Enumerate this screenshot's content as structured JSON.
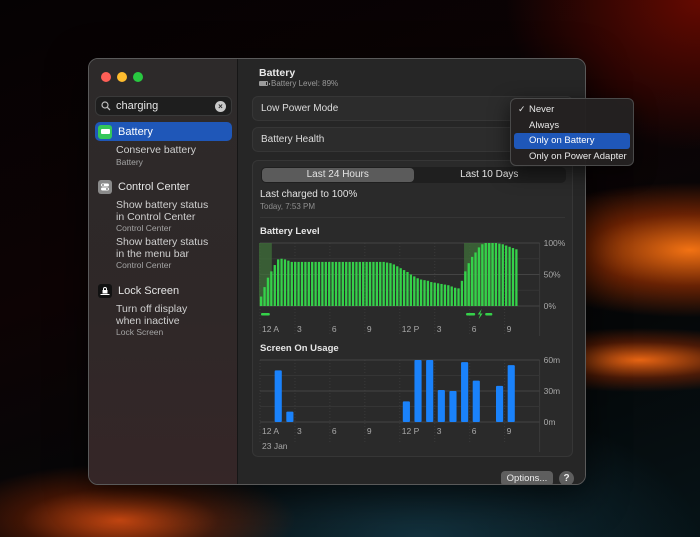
{
  "window": {
    "traffic_lights": [
      "close",
      "minimize",
      "zoom"
    ]
  },
  "sidebar": {
    "search": {
      "value": "charging",
      "placeholder": "Search"
    },
    "results": [
      {
        "label": "Battery",
        "icon": "battery-icon",
        "active": true,
        "subitems": [
          {
            "title": "Conserve battery",
            "category": "Battery"
          }
        ]
      },
      {
        "label": "Control Center",
        "icon": "control-center-icon",
        "active": false,
        "subitems": [
          {
            "title": "Show battery status in Control Center",
            "category": "Control Center"
          },
          {
            "title": "Show battery status in the menu bar",
            "category": "Control Center"
          }
        ]
      },
      {
        "label": "Lock Screen",
        "icon": "lock-screen-icon",
        "active": false,
        "subitems": [
          {
            "title": "Turn off display when inactive",
            "category": "Lock Screen"
          }
        ]
      }
    ]
  },
  "main": {
    "header": {
      "title": "Battery",
      "subtitle": "Battery Level: 89%"
    },
    "rows": [
      {
        "label": "Low Power Mode"
      },
      {
        "label": "Battery Health"
      }
    ],
    "tabs": [
      {
        "label": "Last 24 Hours",
        "selected": true
      },
      {
        "label": "Last 10 Days",
        "selected": false
      }
    ],
    "last_charged": {
      "title": "Last charged to 100%",
      "time": "Today, 7:53 PM"
    },
    "options_label": "Options...",
    "help_label": "?"
  },
  "dropdown": {
    "items": [
      {
        "label": "Never",
        "checked": true,
        "highlighted": false
      },
      {
        "label": "Always",
        "checked": false,
        "highlighted": false
      },
      {
        "label": "Only on Battery",
        "checked": false,
        "highlighted": true
      },
      {
        "label": "Only on Power Adapter",
        "checked": false,
        "highlighted": false
      }
    ]
  },
  "colors": {
    "accent": "#1f57b8",
    "battery_bar": "#35d14a",
    "charging_band": "#3f6f3a",
    "usage_bar": "#1a82fb"
  },
  "chart_data": [
    {
      "type": "bar",
      "title": "Battery Level",
      "x_unit": "20-minute intervals from 12 AM",
      "x_tick_labels": [
        "12 A",
        "3",
        "6",
        "9",
        "12 P",
        "3",
        "6",
        "9"
      ],
      "x_tick_hours": [
        0,
        3,
        6,
        9,
        12,
        15,
        18,
        21
      ],
      "y_tick_labels": [
        "100%",
        "50%",
        "0%"
      ],
      "ylim": [
        0,
        100
      ],
      "values": [
        15,
        30,
        45,
        55,
        65,
        74,
        75,
        74,
        72,
        70,
        70,
        70,
        70,
        70,
        70,
        70,
        70,
        70,
        70,
        70,
        70,
        70,
        70,
        70,
        70,
        70,
        70,
        70,
        70,
        70,
        70,
        70,
        70,
        70,
        70,
        70,
        70,
        69,
        68,
        66,
        63,
        60,
        57,
        54,
        50,
        47,
        44,
        42,
        41,
        40,
        38,
        37,
        36,
        35,
        34,
        33,
        31,
        29,
        28,
        40,
        55,
        68,
        78,
        85,
        93,
        98,
        100,
        100,
        100,
        100,
        99,
        98,
        96,
        94,
        92,
        90
      ],
      "charging_periods_hours": [
        [
          0,
          1.1
        ],
        [
          17.6,
          20.2
        ]
      ],
      "grid": true
    },
    {
      "type": "bar",
      "title": "Screen On Usage",
      "x_unit": "hour of day",
      "x_tick_labels": [
        "12 A",
        "3",
        "6",
        "9",
        "12 P",
        "3",
        "6",
        "9"
      ],
      "x_tick_hours": [
        0,
        3,
        6,
        9,
        12,
        15,
        18,
        21
      ],
      "date_label": "23 Jan",
      "y_tick_labels": [
        "60m",
        "30m",
        "0m"
      ],
      "ylim": [
        0,
        60
      ],
      "values": [
        0,
        50,
        10,
        0,
        0,
        0,
        0,
        0,
        0,
        0,
        0,
        0,
        20,
        60,
        60,
        31,
        30,
        58,
        40,
        0,
        35,
        55
      ],
      "grid": true
    }
  ]
}
